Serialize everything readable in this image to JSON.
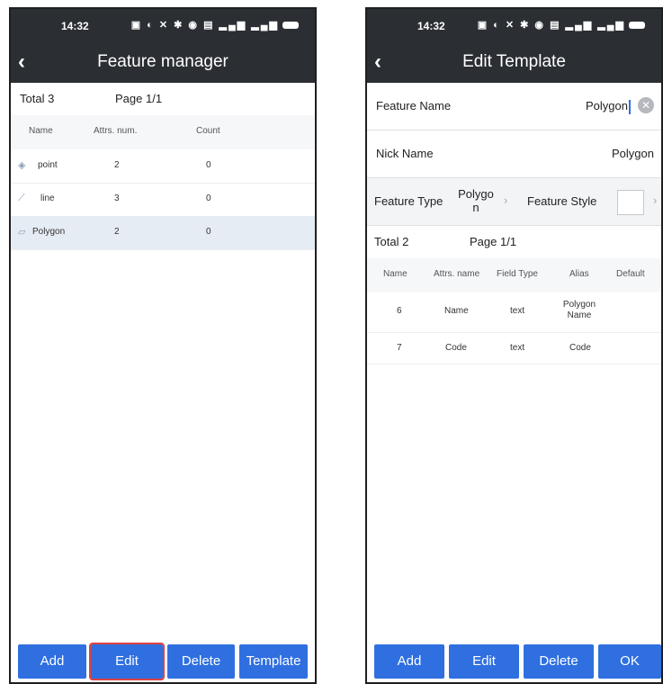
{
  "left": {
    "status": {
      "time": "14:32"
    },
    "title": "Feature manager",
    "total": "Total 3",
    "page": "Page 1/1",
    "headers": {
      "name": "Name",
      "attrs": "Attrs. num.",
      "count": "Count"
    },
    "rows": [
      {
        "icon": "point-icon",
        "glyph": "◈",
        "name": "point",
        "attrs": "2",
        "count": "0"
      },
      {
        "icon": "line-icon",
        "glyph": "⟋",
        "name": "line",
        "attrs": "3",
        "count": "0"
      },
      {
        "icon": "polygon-icon",
        "glyph": "▱",
        "name": "Polygon",
        "attrs": "2",
        "count": "0"
      }
    ],
    "buttons": {
      "add": "Add",
      "edit": "Edit",
      "delete": "Delete",
      "template": "Template"
    }
  },
  "right": {
    "status": {
      "time": "14:32"
    },
    "title": "Edit Template",
    "feature_name": {
      "label": "Feature Name",
      "value": "Polygon"
    },
    "nick_name": {
      "label": "Nick Name",
      "value": "Polygon"
    },
    "feature_type": {
      "label": "Feature Type",
      "value_line1": "Polygo",
      "value_line2": "n"
    },
    "feature_style": {
      "label": "Feature Style"
    },
    "total": "Total 2",
    "page": "Page 1/1",
    "headers": {
      "name": "Name",
      "attrs_name": "Attrs. name",
      "field_type": "Field Type",
      "alias": "Alias",
      "default": "Default"
    },
    "rows": [
      {
        "name": "6",
        "attrs_name": "Name",
        "field_type": "text",
        "alias_line1": "Polygon",
        "alias_line2": "Name"
      },
      {
        "name": "7",
        "attrs_name": "Code",
        "field_type": "text",
        "alias_line1": "Code",
        "alias_line2": ""
      }
    ],
    "buttons": {
      "add": "Add",
      "edit": "Edit",
      "delete": "Delete",
      "ok": "OK"
    }
  },
  "colors": {
    "header_bg": "#2b2e33",
    "button_blue": "#2f6fe0",
    "selected_row": "#e6ecf4",
    "highlight_border": "#e04040"
  }
}
